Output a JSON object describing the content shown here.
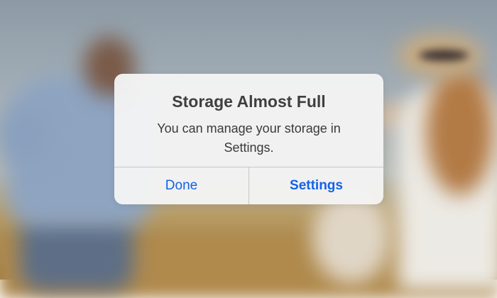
{
  "alert": {
    "title": "Storage Almost Full",
    "message": "You can manage your storage in Settings.",
    "buttons": {
      "done_label": "Done",
      "settings_label": "Settings"
    }
  },
  "colors": {
    "button_text": "#1462e6",
    "title_text": "#3f3f3f",
    "alert_background": "#f4f4f4"
  }
}
